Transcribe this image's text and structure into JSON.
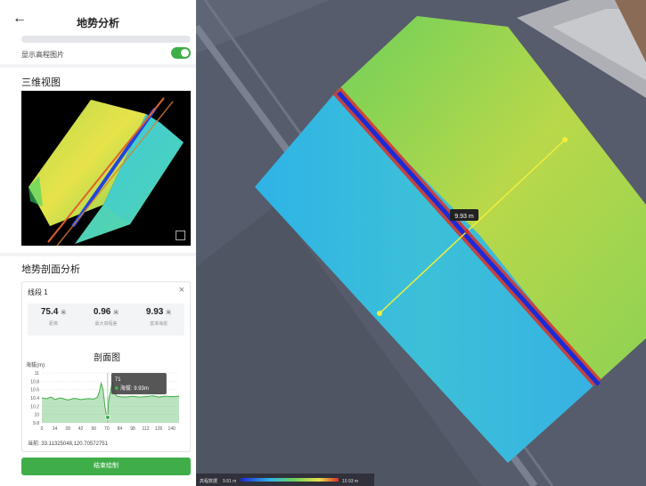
{
  "header": {
    "title": "地势分析",
    "back_icon": "arrow-left-icon"
  },
  "settings": {
    "show_elevation_label": "显示高程图片",
    "show_elevation_on": true
  },
  "view3d": {
    "title": "三维视图",
    "expand_icon": "expand-icon"
  },
  "profile": {
    "title": "地势剖面分析",
    "segment_label": "线段 1",
    "stats": [
      {
        "value": "75.4",
        "unit": "米",
        "label": "距离"
      },
      {
        "value": "0.96",
        "unit": "米",
        "label": "最大高程差"
      },
      {
        "value": "9.93",
        "unit": "米",
        "label": "基准海拔"
      }
    ],
    "coordinates": "当前: 33.11325048,120.70572751",
    "end_button": "结束绘制"
  },
  "chart_data": {
    "type": "area",
    "title": "剖面图",
    "ylabel": "海拔(m)",
    "xlabel": "",
    "ylim": [
      9.8,
      11
    ],
    "yticks": [
      "11",
      "10.8",
      "10.6",
      "10.4",
      "10.2",
      "10",
      "9.8"
    ],
    "xticks": [
      "0",
      "14",
      "28",
      "42",
      "56",
      "70",
      "84",
      "98",
      "112",
      "126",
      "140"
    ],
    "x": [
      0,
      5,
      10,
      14,
      20,
      28,
      35,
      42,
      50,
      56,
      60,
      62,
      64,
      66,
      68,
      70,
      71,
      72,
      74,
      76,
      78,
      80,
      84,
      90,
      98,
      105,
      112,
      120,
      126,
      133,
      140,
      148
    ],
    "y": [
      10.4,
      10.38,
      10.42,
      10.36,
      10.4,
      10.35,
      10.39,
      10.36,
      10.38,
      10.37,
      10.42,
      10.55,
      10.75,
      10.6,
      10.2,
      9.93,
      9.93,
      10.35,
      10.55,
      10.8,
      10.6,
      10.45,
      10.43,
      10.42,
      10.44,
      10.42,
      10.43,
      10.45,
      10.42,
      10.44,
      10.43,
      10.44
    ],
    "tooltip": {
      "x_label": "71",
      "value_label": "海拔: 9.93m"
    },
    "color": "#3fae49",
    "grid": true
  },
  "map": {
    "line_label": "9.93 m",
    "legend_label": "高程数据",
    "legend_min": "9.81 m",
    "legend_max": "10.93 m"
  }
}
